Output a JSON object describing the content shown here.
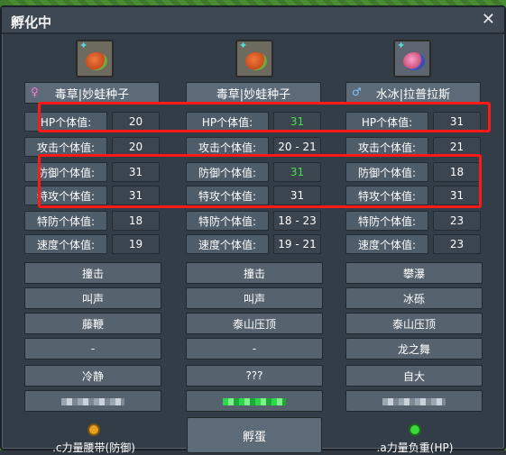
{
  "window": {
    "title": "孵化中",
    "close_glyph": "✕"
  },
  "columns": [
    {
      "icon": "bulbasaur-icon",
      "gender": "♀",
      "name": "毒草|妙蛙种子",
      "stats": [
        {
          "label": "HP个体值:",
          "value": "20"
        },
        {
          "label": "攻击个体值:",
          "value": "20"
        },
        {
          "label": "防御个体值:",
          "value": "31"
        },
        {
          "label": "特攻个体值:",
          "value": "31"
        },
        {
          "label": "特防个体值:",
          "value": "18"
        },
        {
          "label": "速度个体值:",
          "value": "19"
        }
      ],
      "moves": [
        "撞击",
        "叫声",
        "藤鞭",
        "-"
      ],
      "nature": "冷静",
      "item": ".c力量腰带(防御)"
    },
    {
      "icon": "bulbasaur-icon",
      "gender": "",
      "name": "毒草|妙蛙种子",
      "stats": [
        {
          "label": "HP个体值:",
          "value": "31"
        },
        {
          "label": "攻击个体值:",
          "value": "20 - 21"
        },
        {
          "label": "防御个体值:",
          "value": "31"
        },
        {
          "label": "特攻个体值:",
          "value": "31"
        },
        {
          "label": "特防个体值:",
          "value": "18 - 23"
        },
        {
          "label": "速度个体值:",
          "value": "19 - 21"
        }
      ],
      "moves": [
        "撞击",
        "叫声",
        "泰山压顶",
        "-"
      ],
      "nature": "???",
      "action": "孵蛋"
    },
    {
      "icon": "lapras-icon",
      "gender": "♂",
      "name": "水冰|拉普拉斯",
      "stats": [
        {
          "label": "HP个体值:",
          "value": "31"
        },
        {
          "label": "攻击个体值:",
          "value": "21"
        },
        {
          "label": "防御个体值:",
          "value": "18"
        },
        {
          "label": "特攻个体值:",
          "value": "31"
        },
        {
          "label": "特防个体值:",
          "value": "23"
        },
        {
          "label": "速度个体值:",
          "value": "23"
        }
      ],
      "moves": [
        "攀瀑",
        "冰砾",
        "泰山压顶",
        "龙之舞"
      ],
      "nature": "自大",
      "item": ".a力量负重(HP)"
    }
  ],
  "colors": {
    "highlight": "#49e04a",
    "annotation": "#ff1a1a",
    "item_left": "#e8a020",
    "item_right": "#3ad83a"
  }
}
